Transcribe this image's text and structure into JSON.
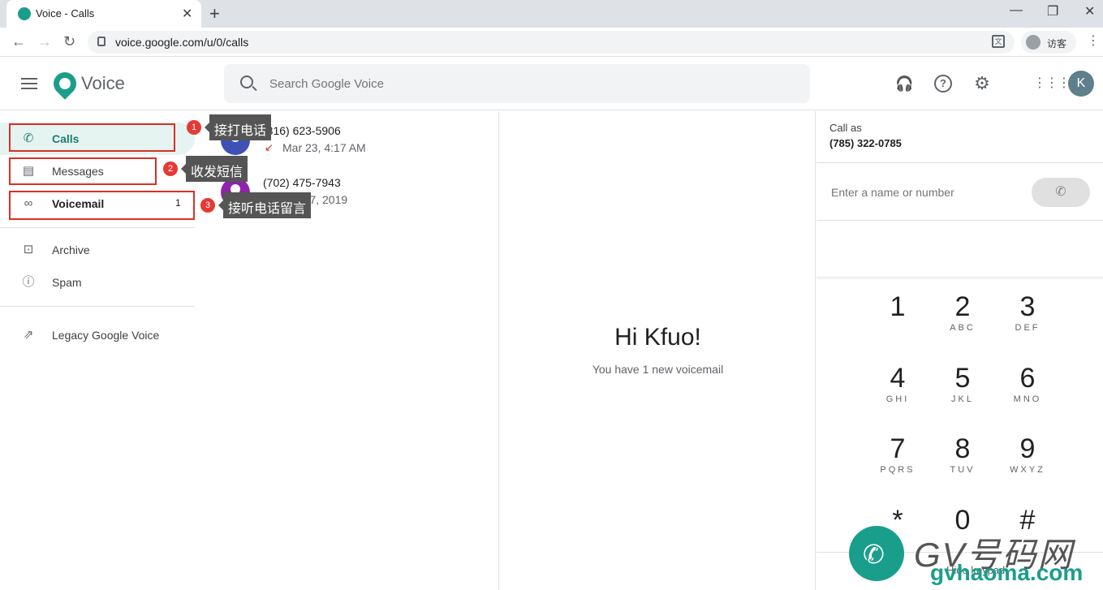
{
  "browser": {
    "tab_title": "Voice - Calls",
    "tab_close": "✕",
    "new_tab": "+",
    "url": "voice.google.com/u/0/calls",
    "profile_name": "访客",
    "win_min": "—",
    "win_max": "❐",
    "win_close": "✕"
  },
  "header": {
    "brand": "Voice",
    "search_placeholder": "Search Google Voice",
    "avatar_letter": "K"
  },
  "sidebar": {
    "items": [
      {
        "label": "Calls",
        "icon": "phone-icon"
      },
      {
        "label": "Messages",
        "icon": "message-icon"
      },
      {
        "label": "Voicemail",
        "icon": "voicemail-icon",
        "count": "1"
      },
      {
        "label": "Archive",
        "icon": "archive-icon"
      },
      {
        "label": "Spam",
        "icon": "spam-icon"
      },
      {
        "label": "Legacy Google Voice",
        "icon": "external-link-icon"
      }
    ]
  },
  "annotations": [
    {
      "num": "1",
      "text": "接打电话"
    },
    {
      "num": "2",
      "text": "收发短信"
    },
    {
      "num": "3",
      "text": "接听电话留言"
    }
  ],
  "calls": [
    {
      "number": "(816) 623-5906",
      "when": "Mar 23, 4:17 AM",
      "avatar_color": "#3f51b5"
    },
    {
      "number": "(702) 475-7943",
      "when": "Oct 17, 2019",
      "avatar_color": "#8e24aa"
    }
  ],
  "welcome": {
    "greeting": "Hi Kfuo!",
    "subtitle": "You have 1 new voicemail"
  },
  "dialer": {
    "call_as_label": "Call as",
    "call_as_number": "(785) 322-0785",
    "input_placeholder": "Enter a name or number",
    "keys": [
      {
        "digit": "1",
        "letters": ""
      },
      {
        "digit": "2",
        "letters": "ABC"
      },
      {
        "digit": "3",
        "letters": "DEF"
      },
      {
        "digit": "4",
        "letters": "GHI"
      },
      {
        "digit": "5",
        "letters": "JKL"
      },
      {
        "digit": "6",
        "letters": "MNO"
      },
      {
        "digit": "7",
        "letters": "PQRS"
      },
      {
        "digit": "8",
        "letters": "TUV"
      },
      {
        "digit": "9",
        "letters": "WXYZ"
      },
      {
        "digit": "*",
        "letters": ""
      },
      {
        "digit": "0",
        "letters": ""
      },
      {
        "digit": "#",
        "letters": ""
      }
    ],
    "hide_keypad": "Hide keypad"
  },
  "watermark": {
    "text": "GV号码网",
    "url": "gvhaoma.com"
  }
}
